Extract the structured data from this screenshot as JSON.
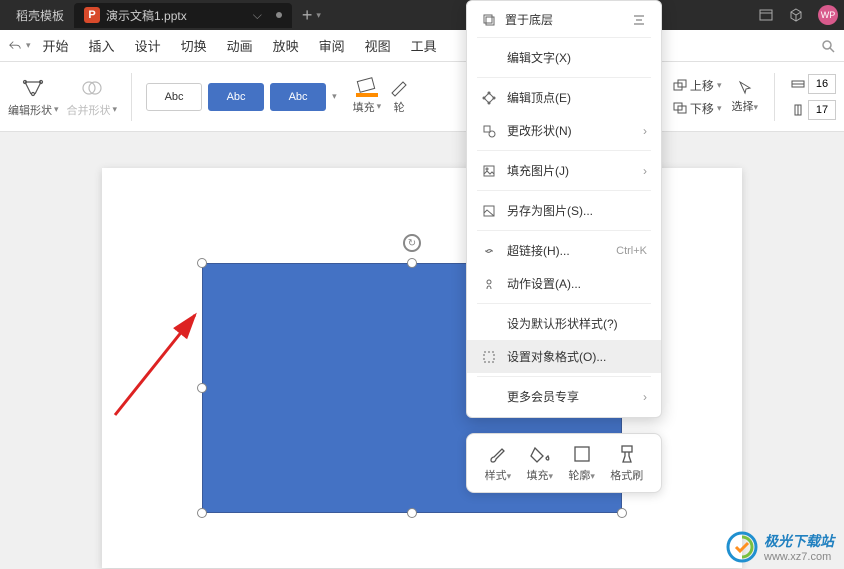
{
  "tabs": {
    "template": "稻壳模板",
    "active": "演示文稿1.pptx"
  },
  "ribbon": {
    "items": [
      "开始",
      "插入",
      "设计",
      "切换",
      "动画",
      "放映",
      "审阅",
      "视图",
      "工具"
    ]
  },
  "toolbar": {
    "edit_shape": "编辑形状",
    "merge_shape": "合并形状",
    "preset_abc": "Abc",
    "fill": "填充",
    "outline": "轮",
    "move_up": "上移",
    "move_down": "下移",
    "select": "选择",
    "num1": "16",
    "num2": "17"
  },
  "context_menu": {
    "top_item": "置于底层",
    "items": [
      {
        "icon": "text",
        "label": "编辑文字(X)"
      },
      {
        "icon": "vertex",
        "label": "编辑顶点(E)"
      },
      {
        "icon": "change",
        "label": "更改形状(N)",
        "arrow": true
      },
      {
        "icon": "image",
        "label": "填充图片(J)",
        "arrow": true
      },
      {
        "icon": "save-img",
        "label": "另存为图片(S)..."
      },
      {
        "icon": "link",
        "label": "超链接(H)...",
        "shortcut": "Ctrl+K"
      },
      {
        "icon": "action",
        "label": "动作设置(A)..."
      },
      {
        "icon": "",
        "label": "设为默认形状样式(?)",
        "indented": true
      },
      {
        "icon": "format",
        "label": "设置对象格式(O)...",
        "highlighted": true
      },
      {
        "icon": "",
        "label": "更多会员专享",
        "indented": true,
        "arrow": true
      }
    ]
  },
  "float_toolbar": {
    "style": "样式",
    "fill": "填充",
    "outline": "轮廓",
    "format_brush": "格式刷"
  },
  "watermark": {
    "name": "极光下载站",
    "url": "www.xz7.com"
  }
}
